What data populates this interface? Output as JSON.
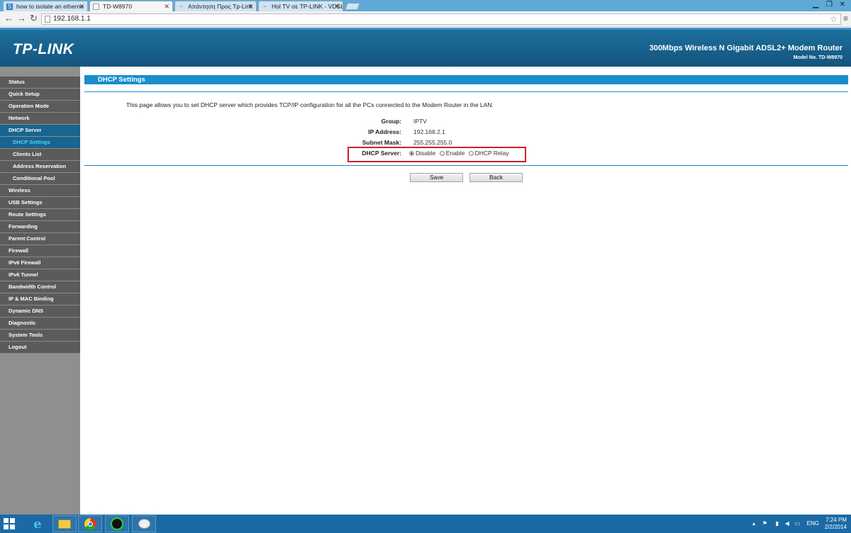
{
  "browser": {
    "tabs": [
      {
        "title": "how to isolate an etherne",
        "favicon": "S",
        "active": false
      },
      {
        "title": "TD-W8970",
        "favicon": "",
        "active": true
      },
      {
        "title": "Απάντηση Προς Tp-Link",
        "favicon": "~",
        "active": false
      },
      {
        "title": "Hol TV σε TP-LINK - VDSL",
        "favicon": "~",
        "active": false
      }
    ],
    "url": "192.168.1.1"
  },
  "header": {
    "logo": "TP-LINK",
    "product": "300Mbps Wireless N Gigabit ADSL2+ Modem Router",
    "model": "Model No. TD-W8970"
  },
  "sidebar": {
    "items": [
      {
        "label": "Status",
        "sub": false,
        "active": false
      },
      {
        "label": "Quick Setup",
        "sub": false,
        "active": false
      },
      {
        "label": "Operation Mode",
        "sub": false,
        "active": false
      },
      {
        "label": "Network",
        "sub": false,
        "active": false
      },
      {
        "label": "DHCP Server",
        "sub": false,
        "active": true
      },
      {
        "label": "DHCP Settings",
        "sub": true,
        "active": true
      },
      {
        "label": "Clients List",
        "sub": true,
        "active": false
      },
      {
        "label": "Address Reservation",
        "sub": true,
        "active": false
      },
      {
        "label": "Conditional Pool",
        "sub": true,
        "active": false
      },
      {
        "label": "Wireless",
        "sub": false,
        "active": false
      },
      {
        "label": "USB Settings",
        "sub": false,
        "active": false
      },
      {
        "label": "Route Settings",
        "sub": false,
        "active": false
      },
      {
        "label": "Forwarding",
        "sub": false,
        "active": false
      },
      {
        "label": "Parent Control",
        "sub": false,
        "active": false
      },
      {
        "label": "Firewall",
        "sub": false,
        "active": false
      },
      {
        "label": "IPv6 Firewall",
        "sub": false,
        "active": false
      },
      {
        "label": "IPv6 Tunnel",
        "sub": false,
        "active": false
      },
      {
        "label": "Bandwidth Control",
        "sub": false,
        "active": false
      },
      {
        "label": "IP & MAC Binding",
        "sub": false,
        "active": false
      },
      {
        "label": "Dynamic DNS",
        "sub": false,
        "active": false
      },
      {
        "label": "Diagnostic",
        "sub": false,
        "active": false
      },
      {
        "label": "System Tools",
        "sub": false,
        "active": false
      },
      {
        "label": "Logout",
        "sub": false,
        "active": false
      }
    ]
  },
  "main": {
    "title": "DHCP Settings",
    "description": "This page allows you to set DHCP server which provides TCP/IP configuration for all the PCs connected to the Modem Router in the LAN.",
    "fields": {
      "group_label": "Group:",
      "group_value": "IPTV",
      "ip_label": "IP Address:",
      "ip_value": "192.168.2.1",
      "mask_label": "Subnet Mask:",
      "mask_value": "255.255.255.0",
      "dhcp_label": "DHCP Server:",
      "dhcp_options": [
        "Disable",
        "Enable",
        "DHCP Relay"
      ],
      "dhcp_selected": "Disable"
    },
    "save_label": "Save",
    "back_label": "Back",
    "highlight_color": "#d0202a"
  },
  "taskbar": {
    "lang": "ENG",
    "time": "7:24 PM",
    "date": "2/2/2014"
  }
}
